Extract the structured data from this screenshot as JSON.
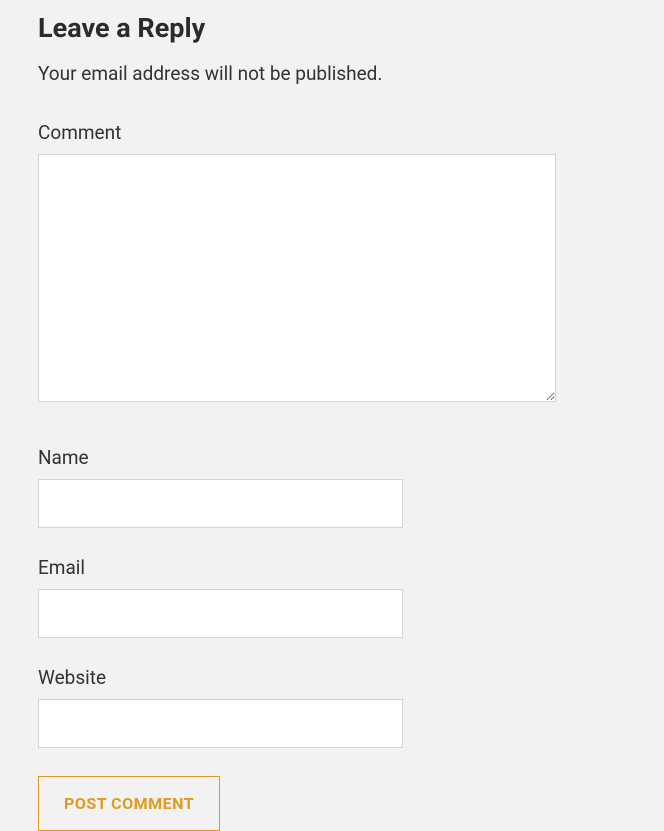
{
  "form": {
    "title": "Leave a Reply",
    "subtitle": "Your email address will not be published.",
    "comment_label": "Comment",
    "name_label": "Name",
    "email_label": "Email",
    "website_label": "Website",
    "submit_label": "POST COMMENT"
  }
}
